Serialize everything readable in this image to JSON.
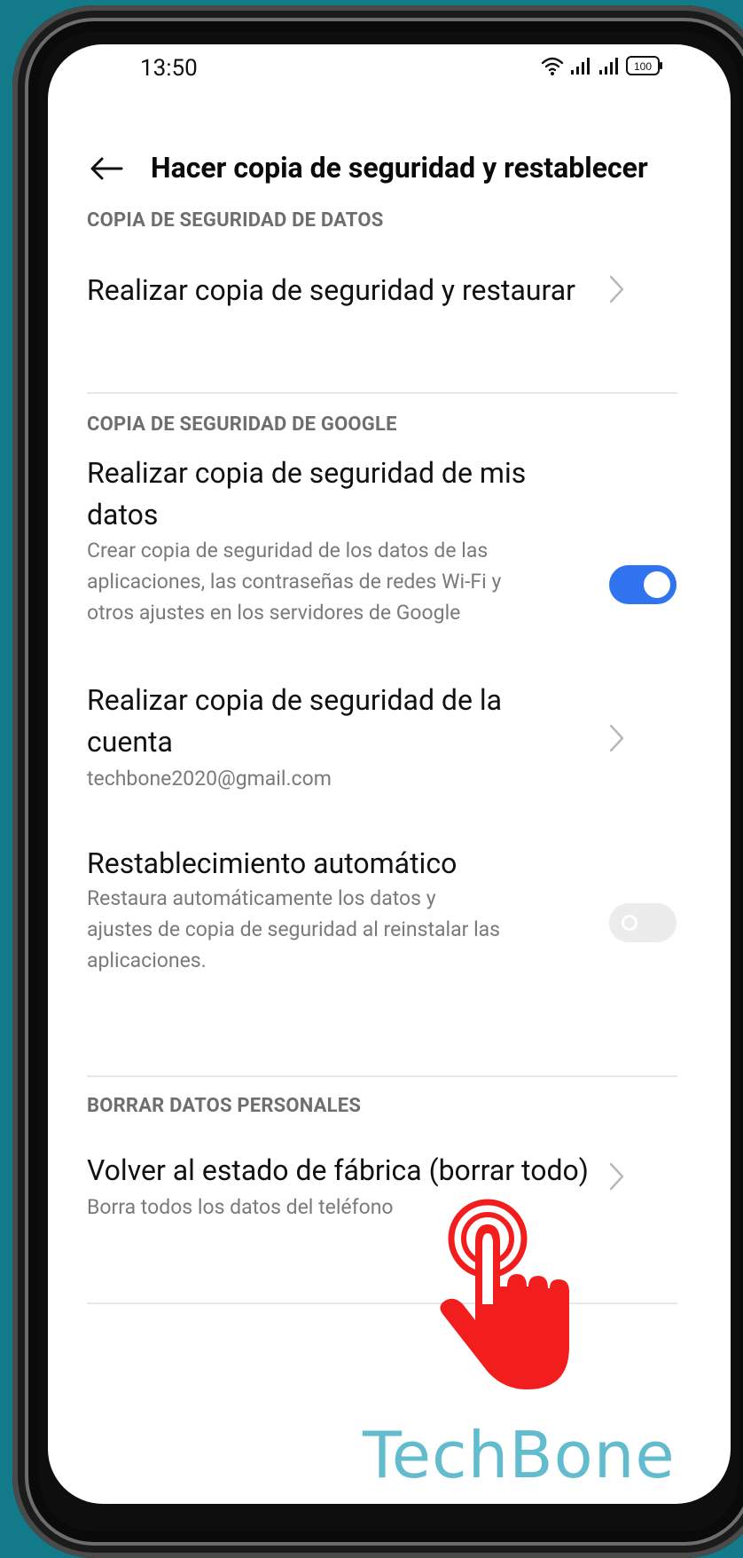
{
  "status_bar": {
    "time": "13:50",
    "battery": "100"
  },
  "header": {
    "title": "Hacer copia de seguridad y restablecer"
  },
  "sections": [
    {
      "label": "COPIA DE SEGURIDAD DE DATOS",
      "items": [
        {
          "title": "Realizar copia de seguridad y restaurar"
        }
      ]
    },
    {
      "label": "COPIA DE SEGURIDAD DE GOOGLE",
      "items": [
        {
          "title_line1": "Realizar copia de seguridad de mis",
          "title_line2": "datos",
          "sub_line1": "Crear copia de seguridad de los datos de las",
          "sub_line2": "aplicaciones, las contraseñas de redes Wi-Fi y",
          "sub_line3": "otros ajustes en los servidores de Google",
          "toggle": "on"
        },
        {
          "title_line1": "Realizar copia de seguridad de la",
          "title_line2": "cuenta",
          "subtitle": "techbone2020@gmail.com"
        },
        {
          "title": "Restablecimiento automático",
          "sub_line1": "Restaura automáticamente los datos y",
          "sub_line2": "ajustes de copia de seguridad al reinstalar las",
          "sub_line3": "aplicaciones.",
          "toggle": "off"
        }
      ]
    },
    {
      "label": "BORRAR DATOS PERSONALES",
      "items": [
        {
          "title": "Volver al estado de fábrica (borrar todo)",
          "subtitle": "Borra todos los datos del teléfono"
        }
      ]
    }
  ],
  "watermark": "TechBone",
  "colors": {
    "background": "#137a8a",
    "accent": "#2f74ee",
    "pointer": "#f21d1d",
    "watermark": "#62bccd"
  },
  "icons": [
    "wifi-icon",
    "signal-icon",
    "battery-icon",
    "back-arrow-icon",
    "chevron-right-icon",
    "tap-hand-icon"
  ]
}
